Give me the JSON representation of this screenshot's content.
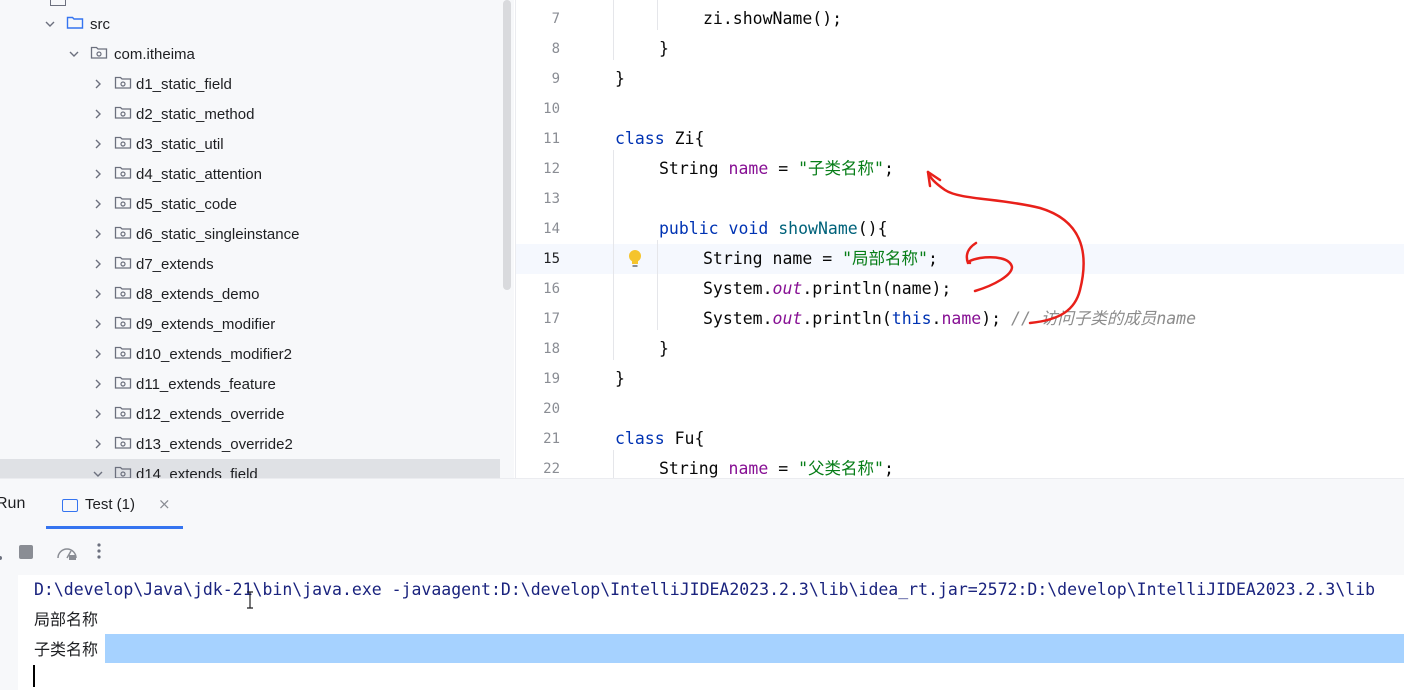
{
  "tree": {
    "items": [
      {
        "label": "src"
      },
      {
        "label": "com.itheima"
      },
      {
        "label": "d1_static_field"
      },
      {
        "label": "d2_static_method"
      },
      {
        "label": "d3_static_util"
      },
      {
        "label": "d4_static_attention"
      },
      {
        "label": "d5_static_code"
      },
      {
        "label": "d6_static_singleinstance"
      },
      {
        "label": "d7_extends"
      },
      {
        "label": "d8_extends_demo"
      },
      {
        "label": "d9_extends_modifier"
      },
      {
        "label": "d10_extends_modifier2"
      },
      {
        "label": "d11_extends_feature"
      },
      {
        "label": "d12_extends_override"
      },
      {
        "label": "d13_extends_override2"
      },
      {
        "label": "d14_extends_field"
      }
    ]
  },
  "editor": {
    "line_numbers": [
      "7",
      "8",
      "9",
      "10",
      "11",
      "12",
      "13",
      "14",
      "15",
      "16",
      "17",
      "18",
      "19",
      "20",
      "21",
      "22"
    ],
    "current_line": "15",
    "code": {
      "l7": "zi.showName();",
      "l8": "}",
      "l9": "}",
      "l11_kw": "class",
      "l11_rest": " Zi{",
      "l12_type": "String ",
      "l12_field": "name",
      "l12_eq": " = ",
      "l12_str": "\"子类名称\"",
      "l12_end": ";",
      "l14_kw": "public void ",
      "l14_fn": "showName",
      "l14_end": "(){",
      "l15_text": "String name = ",
      "l15_str": "\"局部名称\"",
      "l15_end": ";",
      "l16_a": "System.",
      "l16_out": "out",
      "l16_b": ".println(name);",
      "l17_a": "System.",
      "l17_out": "out",
      "l17_b": ".println(",
      "l17_this": "this",
      "l17_dot": ".",
      "l17_field": "name",
      "l17_c": ");",
      "l17_cmt": " // 访问子类的成员name",
      "l18": "}",
      "l19": "}",
      "l21_kw": "class",
      "l21_rest": " Fu{",
      "l22_type": "String ",
      "l22_field": "name",
      "l22_eq": " = ",
      "l22_str": "\"父类名称\"",
      "l22_end": ";"
    }
  },
  "run_panel": {
    "title": "Run",
    "tab_label": "Test (1)",
    "tab_close": "×",
    "console": {
      "command": "D:\\develop\\Java\\jdk-21\\bin\\java.exe -javaagent:D:\\develop\\IntelliJIDEA2023.2.3\\lib\\idea_rt.jar=2572:D:\\develop\\IntelliJIDEA2023.2.3\\lib",
      "output_1": "局部名称",
      "output_2": "子类名称"
    }
  },
  "colors": {
    "keyword": "#0033b3",
    "field": "#871094",
    "string": "#067d17",
    "selection": "#a6d2ff",
    "annotation": "#e8201a"
  }
}
